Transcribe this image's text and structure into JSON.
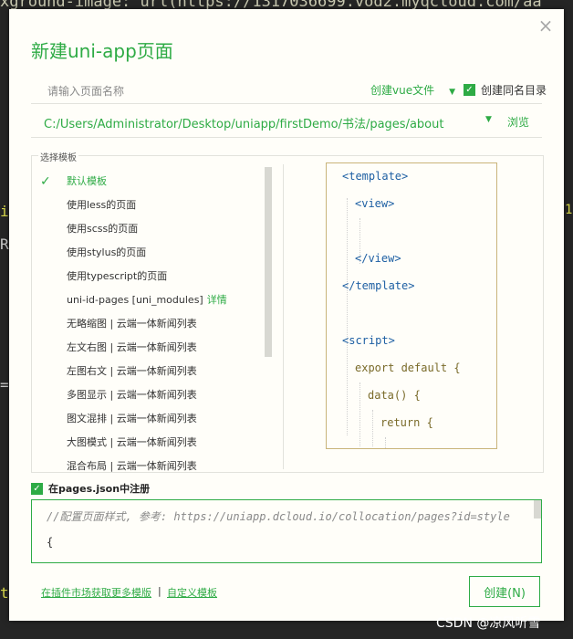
{
  "background": {
    "code_line": "xground-image: url(https://1317036699.vod2.myqcloud.com/aa",
    "left_bits": [
      "i",
      "R",
      "=",
      "t"
    ],
    "right_bit": "1("
  },
  "dialog": {
    "title": "新建uni-app页面",
    "close_icon": "×",
    "name_placeholder": "请输入页面名称",
    "file_type": "创建vue文件",
    "caret": "▼",
    "same_dir_label": "创建同名目录",
    "check_mark": "✓",
    "path": "C:/Users/Administrator/Desktop/uniapp/firstDemo/书法/pages/about",
    "browse_label": "浏览"
  },
  "templates": {
    "legend": "选择模板",
    "items": [
      {
        "label": "默认模板",
        "selected": true
      },
      {
        "label": "使用less的页面",
        "selected": false
      },
      {
        "label": "使用scss的页面",
        "selected": false
      },
      {
        "label": "使用stylus的页面",
        "selected": false
      },
      {
        "label": "使用typescript的页面",
        "selected": false
      },
      {
        "label": "uni-id-pages [uni_modules]",
        "selected": false,
        "detail": "详情"
      },
      {
        "label": "无略缩图 | 云端一体新闻列表",
        "selected": false
      },
      {
        "label": "左文右图 | 云端一体新闻列表",
        "selected": false
      },
      {
        "label": "左图右文 | 云端一体新闻列表",
        "selected": false
      },
      {
        "label": "多图显示 | 云端一体新闻列表",
        "selected": false
      },
      {
        "label": "图文混排 | 云端一体新闻列表",
        "selected": false
      },
      {
        "label": "大图模式 | 云端一体新闻列表",
        "selected": false
      },
      {
        "label": "混合布局 | 云端一体新闻列表",
        "selected": false
      }
    ]
  },
  "preview": {
    "lines": [
      "<template>",
      "<view>",
      "</view>",
      "</template>",
      "<script>",
      "export default {",
      "data() {",
      "return {"
    ]
  },
  "register": {
    "label": "在pages.json中注册",
    "json_comment": "//配置页面样式, 参考: https://uniapp.dcloud.io/collocation/pages?id=style",
    "json_brace": "{"
  },
  "footer": {
    "market_link": "在插件市场获取更多模版",
    "separator": "|",
    "custom_link": "自定义模板",
    "create_button": "创建(N)"
  },
  "watermark": "CSDN @凉风听雪",
  "colors": {
    "accent": "#2eab45",
    "preview_border": "#c9b47a",
    "code_blue": "#1d5fa3"
  }
}
